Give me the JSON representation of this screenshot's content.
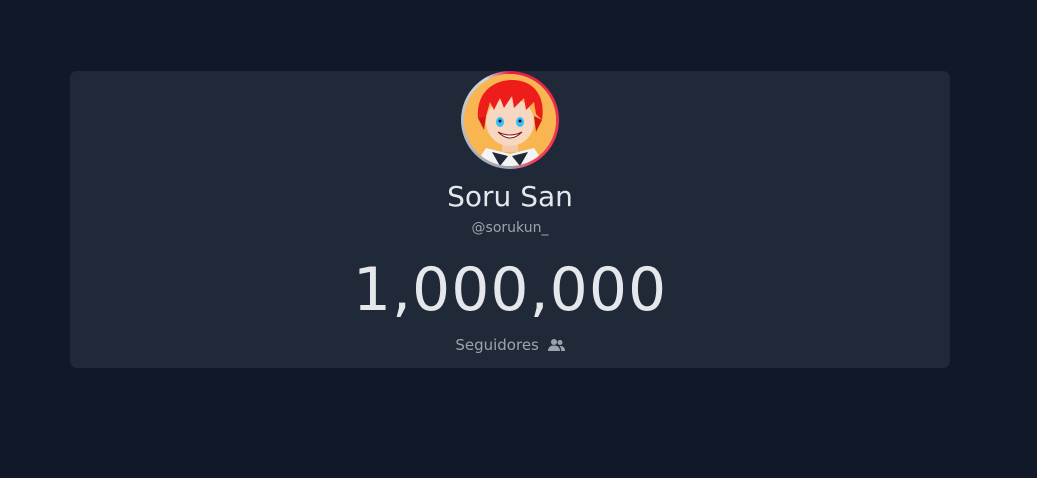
{
  "profile": {
    "name": "Soru San",
    "handle": "@sorukun_",
    "follower_count": "1,000,000",
    "followers_label": "Seguidores",
    "followers_icon": "users-icon",
    "avatar_icon": "avatar-image"
  },
  "colors": {
    "background": "#111827",
    "card": "#1f2937",
    "text_primary": "#e5e7eb",
    "text_secondary": "#9ca3af",
    "avatar_ring": "#e11d48"
  }
}
